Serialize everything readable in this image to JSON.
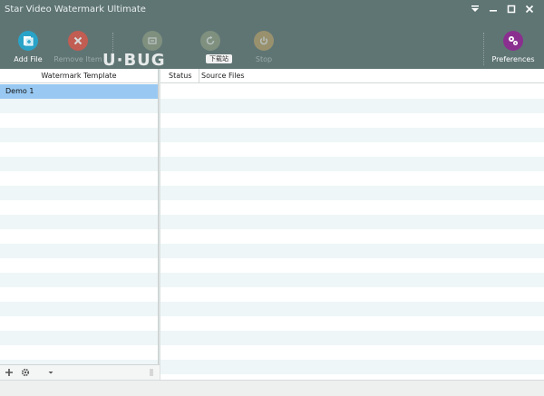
{
  "window": {
    "title": "Star Video Watermark Ultimate",
    "controls": [
      "menu",
      "minimize",
      "maximize",
      "close"
    ]
  },
  "toolbar": {
    "buttons": [
      {
        "label": "Add File",
        "icon": "add-file-icon",
        "enabled": true
      },
      {
        "label": "Remove Item",
        "icon": "remove-item-icon",
        "enabled": false
      },
      {
        "label": "",
        "icon": "output-icon",
        "enabled": false
      },
      {
        "label": "",
        "icon": "refresh-icon",
        "enabled": false
      },
      {
        "label": "Stop",
        "icon": "stop-icon",
        "enabled": false
      },
      {
        "label": "Preferences",
        "icon": "gears-icon",
        "enabled": true
      }
    ],
    "watermark_badge": "下载站",
    "logo_text": "U·BUG"
  },
  "left_panel": {
    "header": "Watermark Template",
    "templates": [
      {
        "name": "Demo 1",
        "selected": true
      }
    ]
  },
  "right_panel": {
    "columns": [
      "Status",
      "Source Files"
    ],
    "rows": []
  },
  "colors": {
    "toolbar_bg": "#5f7574",
    "selection": "#99c9f2",
    "stripe": "#eef6f7",
    "add_icon": "#2aa3c8",
    "remove_icon": "#e25547",
    "preferences_icon": "#8a2f8f"
  }
}
